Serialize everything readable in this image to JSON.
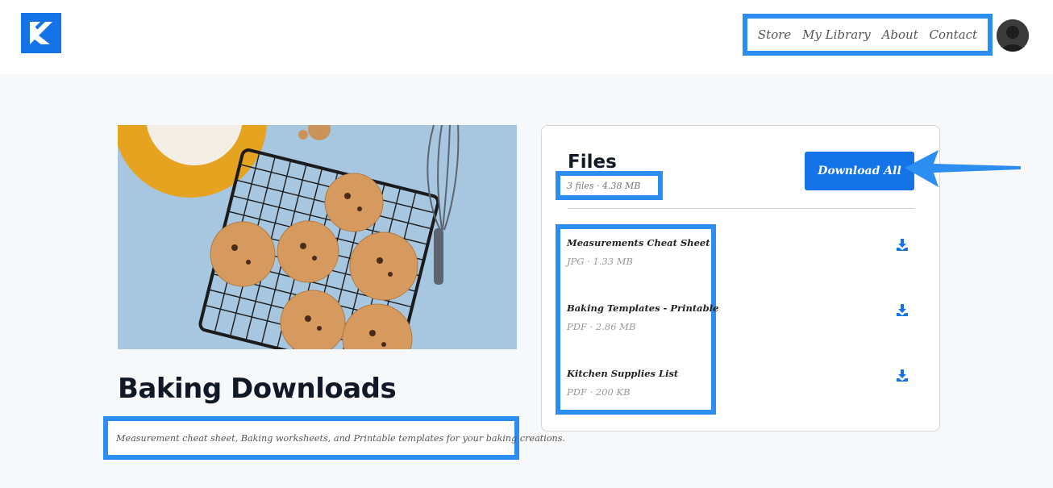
{
  "header": {
    "nav": [
      {
        "label": "Store"
      },
      {
        "label": "My Library"
      },
      {
        "label": "About"
      },
      {
        "label": "Contact"
      }
    ]
  },
  "product": {
    "title": "Baking Downloads",
    "description": "Measurement cheat sheet, Baking worksheets, and Printable templates for your baking creations."
  },
  "files_panel": {
    "title": "Files",
    "meta": "3 files · 4.38 MB",
    "download_all_label": "Download All",
    "files": [
      {
        "name": "Measurements Cheat Sheet",
        "meta": "JPG · 1.33 MB"
      },
      {
        "name": "Baking Templates - Printable",
        "meta": "PDF · 2.86 MB"
      },
      {
        "name": "Kitchen Supplies List",
        "meta": "PDF · 200 KB"
      }
    ]
  },
  "colors": {
    "accent": "#1473e6",
    "highlight": "#2b8ef0"
  },
  "icons": {
    "logo": "brand-logo-icon",
    "avatar": "user-avatar",
    "download": "download-icon",
    "pointer": "pointer-arrow"
  }
}
